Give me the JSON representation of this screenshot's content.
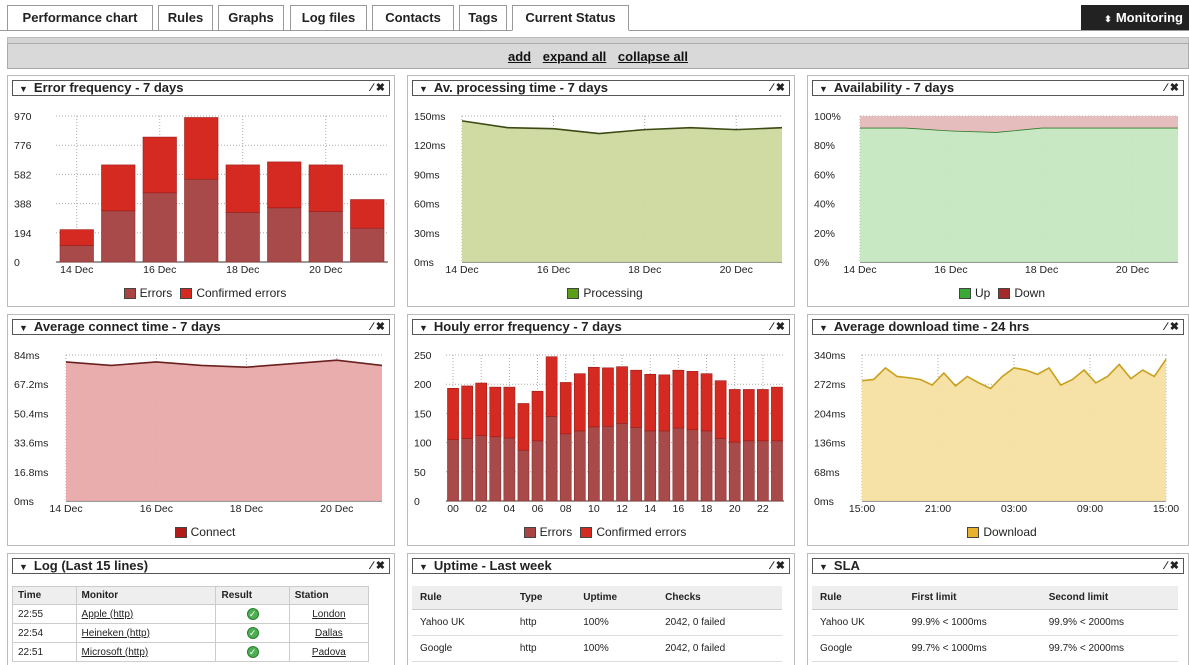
{
  "tabs": [
    "Performance chart",
    "Rules",
    "Graphs",
    "Log files",
    "Contacts",
    "Tags",
    "Current Status"
  ],
  "active_tab": "Current Status",
  "monitoring_label": "Monitoring",
  "actions": {
    "add": "add",
    "expand_all": "expand all",
    "collapse_all": "collapse all"
  },
  "panels": {
    "error_frequency": {
      "title": "Error frequency - 7 days"
    },
    "processing": {
      "title": "Av. processing time - 7 days"
    },
    "availability": {
      "title": "Availability - 7 days"
    },
    "connect": {
      "title": "Average connect time - 7 days"
    },
    "hourly": {
      "title": "Houly error frequency - 7 days"
    },
    "download": {
      "title": "Average download time - 24 hrs"
    },
    "log": {
      "title": "Log (Last 15 lines)"
    },
    "uptime": {
      "title": "Uptime - Last week"
    },
    "sla": {
      "title": "SLA"
    }
  },
  "colors": {
    "errors": "#a94442",
    "confirmed": "#d42a22",
    "processing": "#c9d79a",
    "up": "#c4e6c0",
    "down": "#e6bcbc",
    "connect": "#e8a9a9",
    "download": "#f6dfa0"
  },
  "chart_data": [
    {
      "type": "bar",
      "title": "Error frequency - 7 days",
      "categories": [
        "14 Dec",
        "15 Dec",
        "16 Dec",
        "17 Dec",
        "18 Dec",
        "19 Dec",
        "20 Dec",
        "21 Dec"
      ],
      "x_ticks": [
        "14 Dec",
        "16 Dec",
        "18 Dec",
        "20 Dec"
      ],
      "y_ticks": [
        "0",
        "194",
        "388",
        "582",
        "776",
        "970"
      ],
      "ylim": [
        0,
        970
      ],
      "stacked": true,
      "series": [
        {
          "name": "Errors",
          "values": [
            110,
            340,
            460,
            550,
            330,
            360,
            335,
            225
          ]
        },
        {
          "name": "Confirmed errors",
          "values": [
            105,
            305,
            370,
            410,
            315,
            305,
            310,
            190
          ]
        }
      ]
    },
    {
      "type": "area",
      "title": "Av. processing time - 7 days",
      "x": [
        0,
        1,
        2,
        3,
        4,
        5,
        6,
        7
      ],
      "x_ticks": [
        "14 Dec",
        "16 Dec",
        "18 Dec",
        "20 Dec"
      ],
      "y_ticks": [
        "0ms",
        "30ms",
        "60ms",
        "90ms",
        "120ms",
        "150ms"
      ],
      "ylim": [
        0,
        150
      ],
      "series": [
        {
          "name": "Processing",
          "values": [
            145,
            138,
            137,
            132,
            136,
            138,
            136,
            138
          ]
        }
      ]
    },
    {
      "type": "area",
      "title": "Availability - 7 days",
      "x_ticks": [
        "14 Dec",
        "16 Dec",
        "18 Dec",
        "20 Dec"
      ],
      "y_ticks": [
        "0%",
        "20%",
        "40%",
        "60%",
        "80%",
        "100%"
      ],
      "ylim": [
        0,
        100
      ],
      "series": [
        {
          "name": "Up",
          "values": [
            92,
            92,
            90,
            89,
            92,
            92,
            92,
            92
          ]
        },
        {
          "name": "Down",
          "values": [
            8,
            8,
            10,
            11,
            8,
            8,
            8,
            8
          ]
        }
      ]
    },
    {
      "type": "area",
      "title": "Average connect time - 7 days",
      "x_ticks": [
        "14 Dec",
        "16 Dec",
        "18 Dec",
        "20 Dec"
      ],
      "y_ticks": [
        "0ms",
        "16.8ms",
        "33.6ms",
        "50.4ms",
        "67.2ms",
        "84ms"
      ],
      "ylim": [
        0,
        84
      ],
      "series": [
        {
          "name": "Connect",
          "values": [
            80,
            78,
            80,
            78,
            77,
            79,
            81,
            78
          ]
        }
      ]
    },
    {
      "type": "bar",
      "title": "Houly error frequency - 7 days",
      "categories": [
        "00",
        "01",
        "02",
        "03",
        "04",
        "05",
        "06",
        "07",
        "08",
        "09",
        "10",
        "11",
        "12",
        "13",
        "14",
        "15",
        "16",
        "17",
        "18",
        "19",
        "20",
        "21",
        "22",
        "23"
      ],
      "x_ticks": [
        "00",
        "02",
        "04",
        "06",
        "08",
        "10",
        "12",
        "14",
        "16",
        "18",
        "20",
        "22"
      ],
      "y_ticks": [
        "0",
        "50",
        "100",
        "150",
        "200",
        "250"
      ],
      "ylim": [
        0,
        250
      ],
      "stacked": true,
      "series": [
        {
          "name": "Errors",
          "values": [
            105,
            107,
            112,
            110,
            108,
            87,
            103,
            145,
            115,
            120,
            127,
            128,
            133,
            126,
            120,
            120,
            125,
            122,
            120,
            107,
            101,
            103,
            103,
            103
          ]
        },
        {
          "name": "Confirmed errors",
          "values": [
            88,
            90,
            90,
            85,
            87,
            80,
            85,
            102,
            88,
            98,
            102,
            100,
            97,
            98,
            97,
            96,
            99,
            100,
            98,
            99,
            90,
            88,
            88,
            92
          ]
        }
      ]
    },
    {
      "type": "area",
      "title": "Average download time - 24 hrs",
      "x_ticks": [
        "15:00",
        "21:00",
        "03:00",
        "09:00",
        "15:00"
      ],
      "y_ticks": [
        "0ms",
        "68ms",
        "136ms",
        "204ms",
        "272ms",
        "340ms"
      ],
      "ylim": [
        0,
        340
      ],
      "series": [
        {
          "name": "Download",
          "values": [
            280,
            283,
            310,
            290,
            287,
            283,
            270,
            298,
            268,
            290,
            275,
            262,
            290,
            310,
            305,
            295,
            310,
            270,
            283,
            305,
            275,
            290,
            318,
            285,
            305,
            290,
            330
          ]
        }
      ]
    }
  ],
  "log": {
    "headers": [
      "Time",
      "Monitor",
      "Result",
      "Station"
    ],
    "rows": [
      {
        "time": "22:55",
        "monitor": "Apple (http)",
        "station": "London"
      },
      {
        "time": "22:54",
        "monitor": "Heineken (http)",
        "station": "Dallas"
      },
      {
        "time": "22:51",
        "monitor": "Microsoft (http)",
        "station": "Padova"
      }
    ]
  },
  "uptime": {
    "headers": [
      "Rule",
      "Type",
      "Uptime",
      "Checks"
    ],
    "rows": [
      [
        "Yahoo UK",
        "http",
        "100%",
        "2042, 0 failed"
      ],
      [
        "Google",
        "http",
        "100%",
        "2042, 0 failed"
      ]
    ]
  },
  "sla": {
    "headers": [
      "Rule",
      "First limit",
      "Second limit"
    ],
    "rows": [
      [
        "Yahoo UK",
        "99.9% < 1000ms",
        "99.9% < 2000ms"
      ],
      [
        "Google",
        "99.7% < 1000ms",
        "99.7% < 2000ms"
      ]
    ]
  }
}
